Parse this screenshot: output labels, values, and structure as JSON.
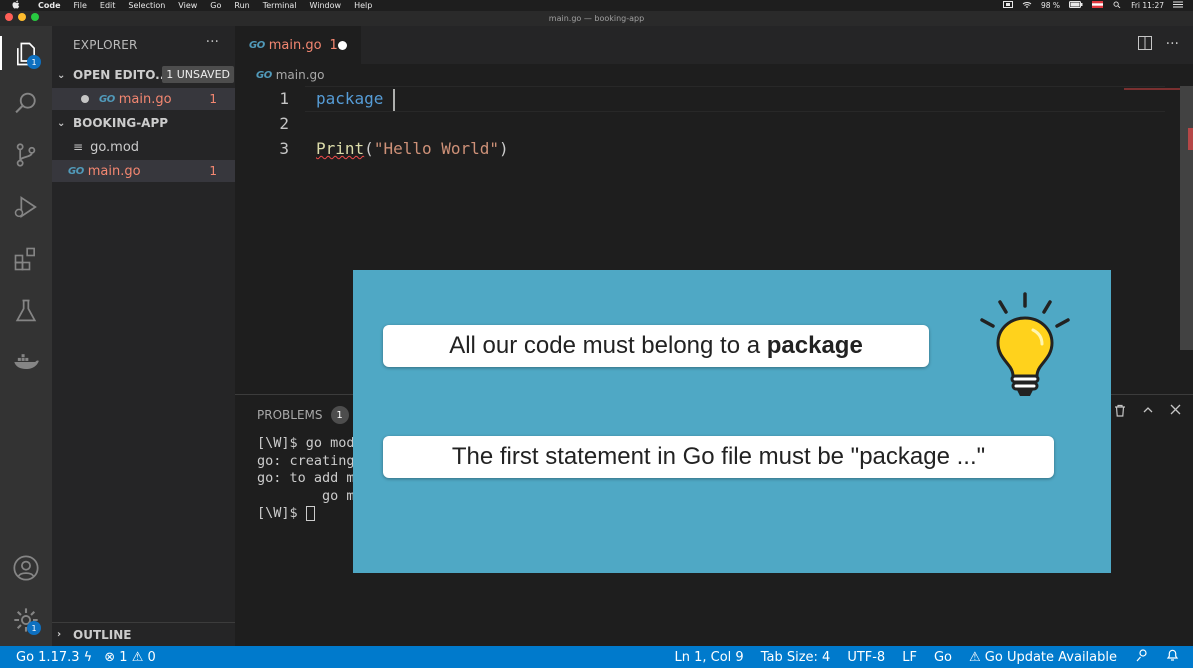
{
  "menubar": {
    "app": "Code",
    "items": [
      "File",
      "Edit",
      "Selection",
      "View",
      "Go",
      "Run",
      "Terminal",
      "Window",
      "Help"
    ],
    "battery": "98 %",
    "clock": "Fri 11:27"
  },
  "window": {
    "title": "main.go — booking-app"
  },
  "activity": {
    "explorer_badge": "1",
    "settings_badge": "1"
  },
  "sidebar": {
    "title": "EXPLORER",
    "more": "···",
    "open_editors": {
      "label": "OPEN EDITO...",
      "badge": "1 UNSAVED",
      "file": "main.go",
      "problems": "1"
    },
    "folder": {
      "label": "BOOKING-APP",
      "files": [
        {
          "name": "go.mod"
        },
        {
          "name": "main.go",
          "problems": "1"
        }
      ]
    },
    "outline": "OUTLINE"
  },
  "editor": {
    "tab": {
      "label": "main.go",
      "problems": "1"
    },
    "breadcrumb": "main.go",
    "lines": [
      {
        "num": "1",
        "keyword": "package "
      },
      {
        "num": "2"
      },
      {
        "num": "3",
        "func": "Print",
        "open": "(",
        "string": "\"Hello World\"",
        "close": ")"
      }
    ]
  },
  "panel": {
    "tab_problems": "PROBLEMS",
    "problems_count": "1",
    "terminal_lines": [
      "[\\W]$ go mod init",
      "go: creating ne",
      "go: to add modu",
      "        go mod tidy",
      "[\\W]$ "
    ]
  },
  "status": {
    "go_version": "Go 1.17.3",
    "errors": "1",
    "warnings": "0",
    "position": "Ln 1, Col 9",
    "tab_size": "Tab Size: 4",
    "encoding": "UTF-8",
    "eol": "LF",
    "language": "Go",
    "update": "Go Update Available"
  },
  "callout": {
    "line1_prefix": "All our code must belong to a ",
    "line1_bold": "package",
    "line2": "The first statement in Go file must be \"package ...\""
  },
  "colors": {
    "accent": "#007acc",
    "overlay": "#4fa8c5",
    "error": "#f48771"
  }
}
